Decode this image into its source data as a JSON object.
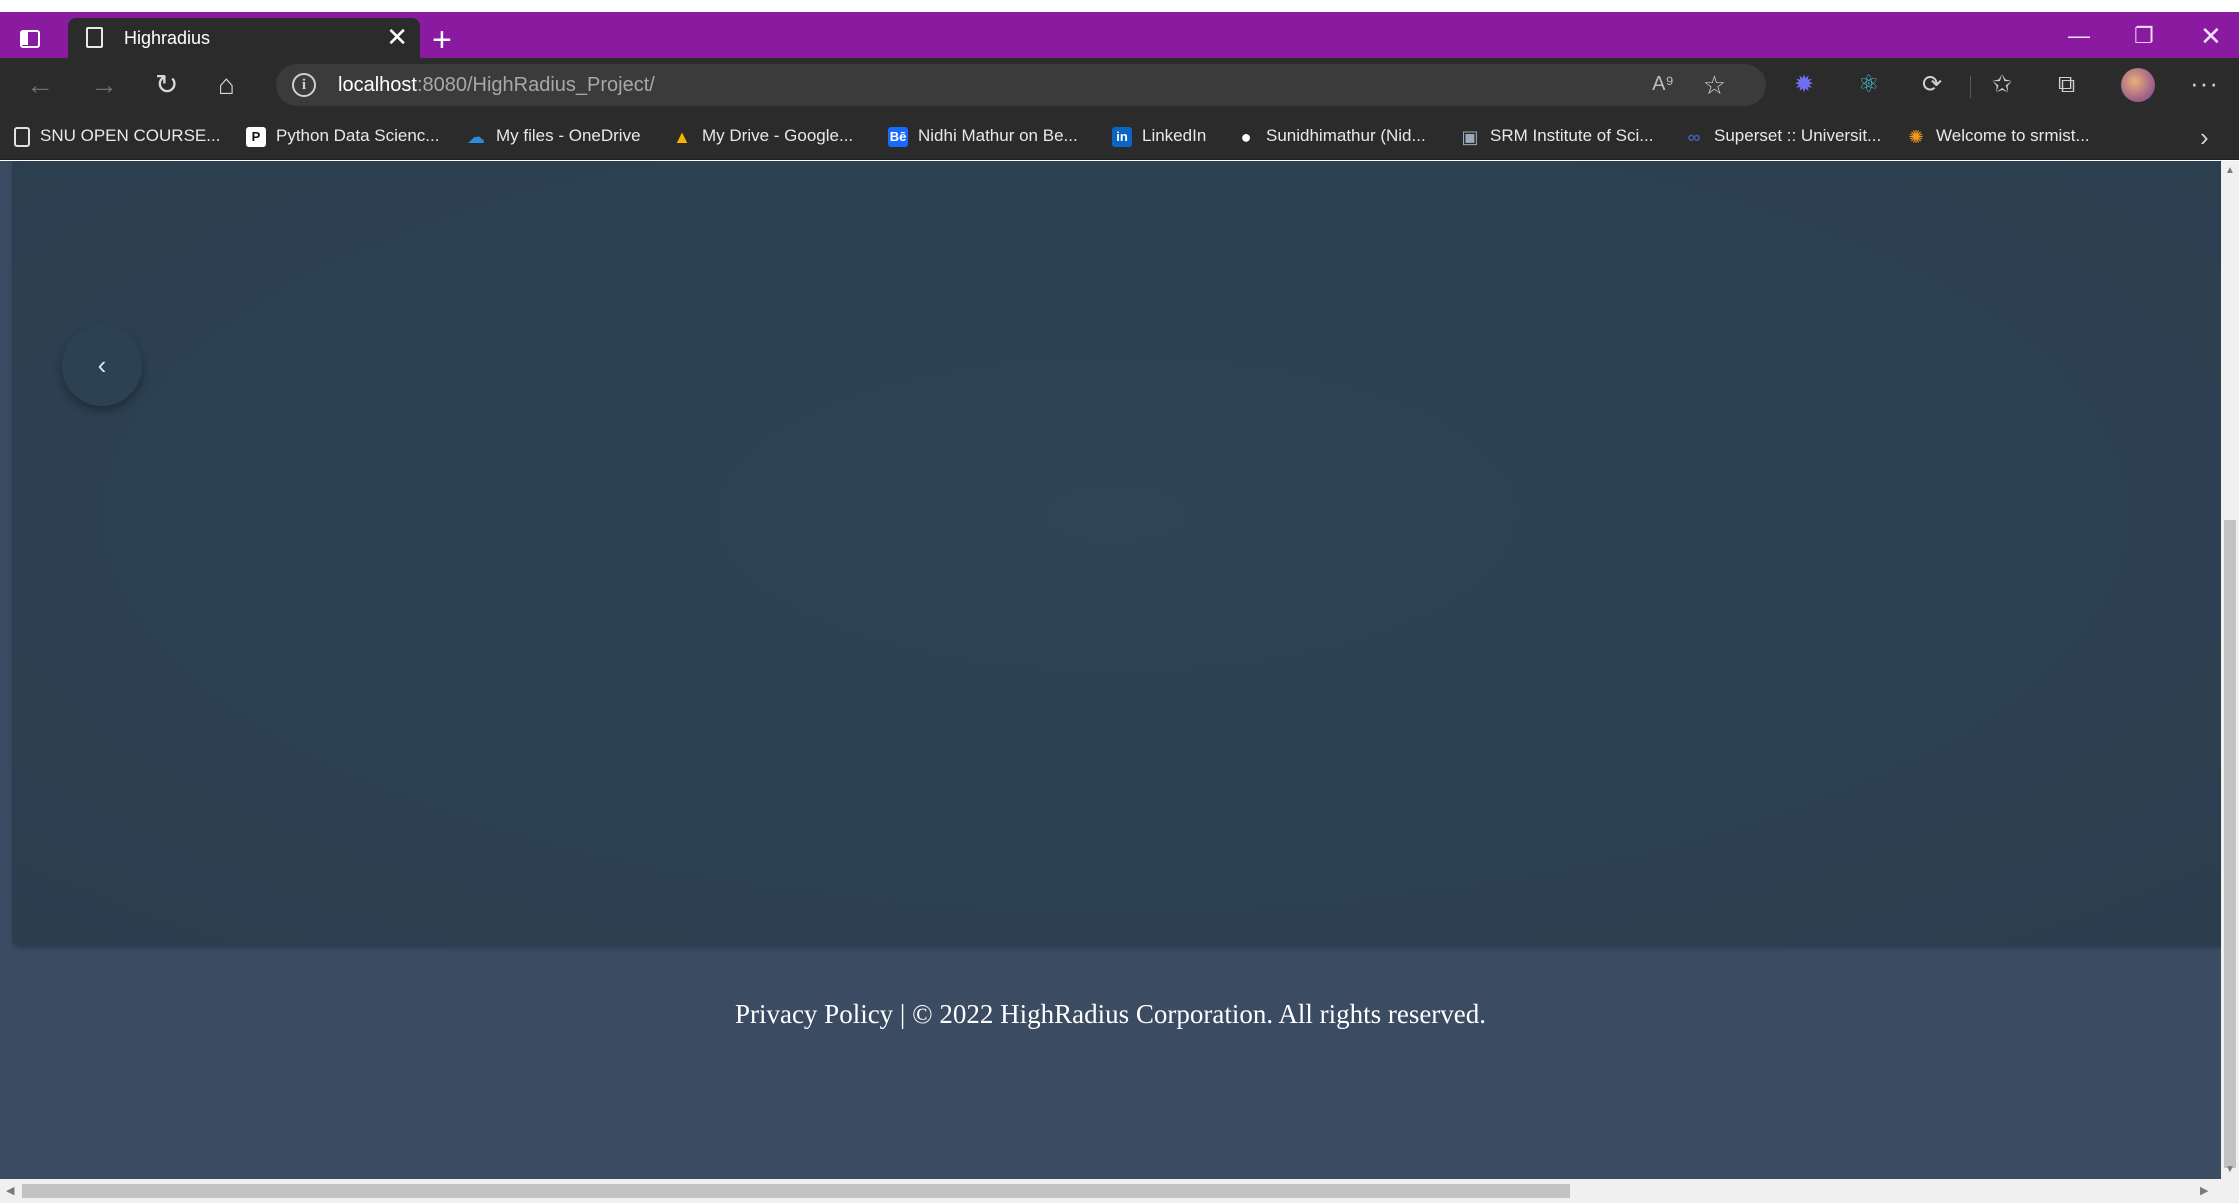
{
  "browser": {
    "tab": {
      "title": "Highradius",
      "close_label": "✕",
      "new_tab_label": "+"
    },
    "window_controls": {
      "minimize": "—",
      "maximize": "❐",
      "close": "✕"
    },
    "address_bar": {
      "host": "localhost",
      "path": ":8080/HighRadius_Project/",
      "info_icon": "i",
      "read_aloud": "A⁹"
    },
    "nav": {
      "back": "←",
      "forward": "→",
      "reload": "↻",
      "home": "⌂"
    },
    "toolbar": {
      "more": "···"
    },
    "bookmarks": [
      {
        "label": "SNU OPEN COURSE...",
        "icon": "page-icon",
        "icon_text": "",
        "color": "#2b2b2b"
      },
      {
        "label": "Python Data Scienc...",
        "icon": "p-icon",
        "icon_text": "P",
        "color": "#ffffff"
      },
      {
        "label": "My files - OneDrive",
        "icon": "onedrive-icon",
        "icon_text": "☁",
        "color": "#2b8cde"
      },
      {
        "label": "My Drive - Google...",
        "icon": "google-drive-icon",
        "icon_text": "▲",
        "color": "#f4b400"
      },
      {
        "label": "Nidhi Mathur on Be...",
        "icon": "behance-icon",
        "icon_text": "Bē",
        "color": "#1769ff"
      },
      {
        "label": "LinkedIn",
        "icon": "linkedin-icon",
        "icon_text": "in",
        "color": "#0a66c2"
      },
      {
        "label": "Sunidhimathur (Nid...",
        "icon": "github-icon",
        "icon_text": "●",
        "color": "#ffffff"
      },
      {
        "label": "SRM Institute of Sci...",
        "icon": "srm-icon",
        "icon_text": "▣",
        "color": "#9ab"
      },
      {
        "label": "Superset :: Universit...",
        "icon": "superset-icon",
        "icon_text": "∞",
        "color": "#3f5fa8"
      },
      {
        "label": "Welcome to srmist...",
        "icon": "srmist-icon",
        "icon_text": "✺",
        "color": "#f09a1f"
      }
    ],
    "bookmarks_more": "›"
  },
  "page": {
    "carousel_prev": "‹",
    "footer": "Privacy Policy | © 2022 HighRadius Corporation. All rights reserved."
  }
}
